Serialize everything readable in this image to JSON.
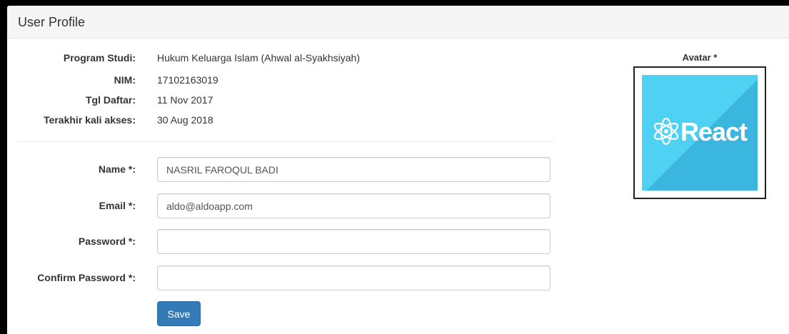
{
  "header": {
    "title": "User Profile"
  },
  "info": [
    {
      "label": "Program Studi:",
      "value": "Hukum Keluarga Islam (Ahwal al-Syakhsiyah)"
    },
    {
      "label": "NIM:",
      "value": "17102163019"
    },
    {
      "label": "Tgl Daftar:",
      "value": "11 Nov 2017"
    },
    {
      "label": "Terakhir kali akses:",
      "value": "30 Aug 2018"
    }
  ],
  "form": {
    "name": {
      "label": "Name *:",
      "value": "NASRIL FAROQUL BADI"
    },
    "email": {
      "label": "Email *:",
      "value": "aldo@aldoapp.com"
    },
    "password": {
      "label": "Password *:",
      "value": ""
    },
    "confirm_password": {
      "label": "Confirm Password *:",
      "value": ""
    },
    "save_label": "Save"
  },
  "avatar": {
    "label": "Avatar *",
    "image_text": "React",
    "image_icon": "react-atom-icon",
    "image_bg": "#4fd1f4"
  },
  "colors": {
    "primary": "#337ab7"
  }
}
